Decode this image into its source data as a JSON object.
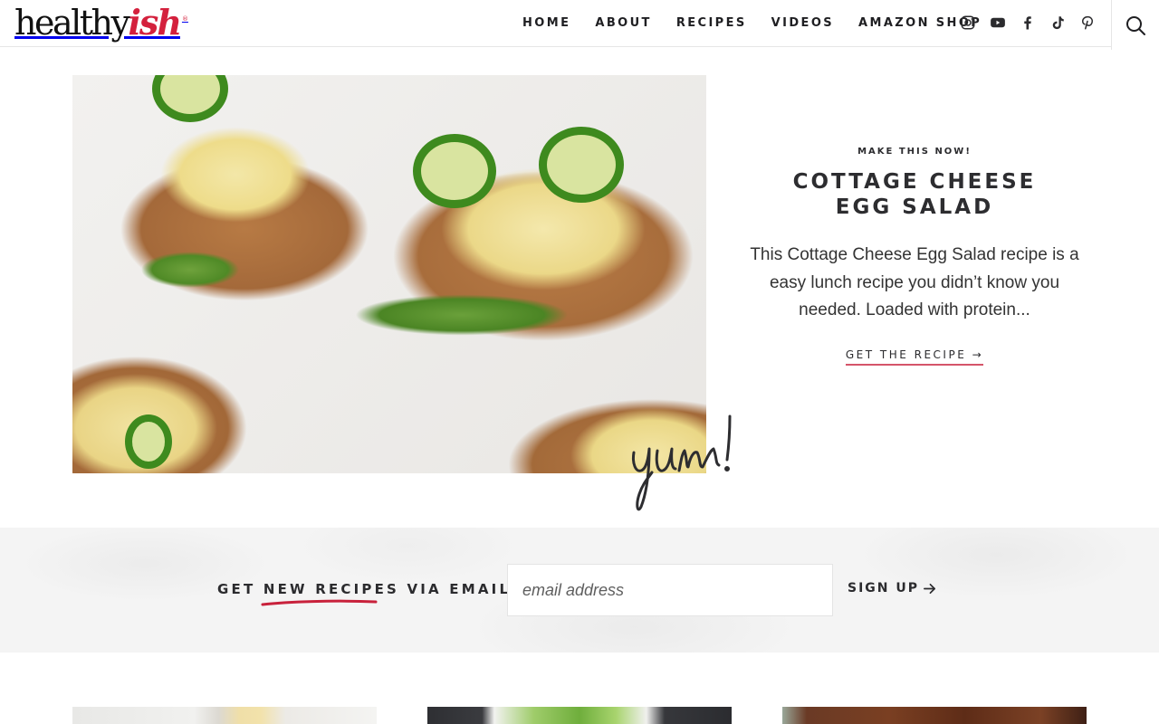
{
  "header": {
    "logo": {
      "main": "healthy",
      "accent": "ish",
      "reg": "®"
    },
    "nav": [
      {
        "label": "HOME"
      },
      {
        "label": "ABOUT"
      },
      {
        "label": "RECIPES"
      },
      {
        "label": "VIDEOS"
      },
      {
        "label": "AMAZON SHOP"
      }
    ],
    "social": [
      {
        "name": "instagram-icon"
      },
      {
        "name": "youtube-icon"
      },
      {
        "name": "facebook-icon"
      },
      {
        "name": "tiktok-icon"
      },
      {
        "name": "pinterest-icon"
      }
    ],
    "search_icon": "search-icon"
  },
  "hero": {
    "image_alt": "Cottage cheese egg salad on toast with avocado, jalapeño and dill",
    "annotation": "yum!",
    "kicker": "MAKE THIS NOW!",
    "title": "COTTAGE CHEESE EGG SALAD",
    "description": "This Cottage Cheese Egg Salad recipe is a easy lunch recipe you didn’t know you needed. Loaded with protein...",
    "cta_label": "GET THE RECIPE →"
  },
  "newsletter": {
    "label_prefix": "GET ",
    "label_highlight": "NEW RECIPES",
    "label_suffix": " VIA EMAIL:",
    "email_placeholder": "email address",
    "email_value": "",
    "signup_label": "SIGN UP"
  },
  "cards": [
    {
      "name": "recipe-card-1"
    },
    {
      "name": "recipe-card-2"
    },
    {
      "name": "recipe-card-3"
    }
  ],
  "colors": {
    "brand_red": "#d4213d",
    "text_dark": "#2b2b2e",
    "cta_underline": "#d5556a"
  }
}
